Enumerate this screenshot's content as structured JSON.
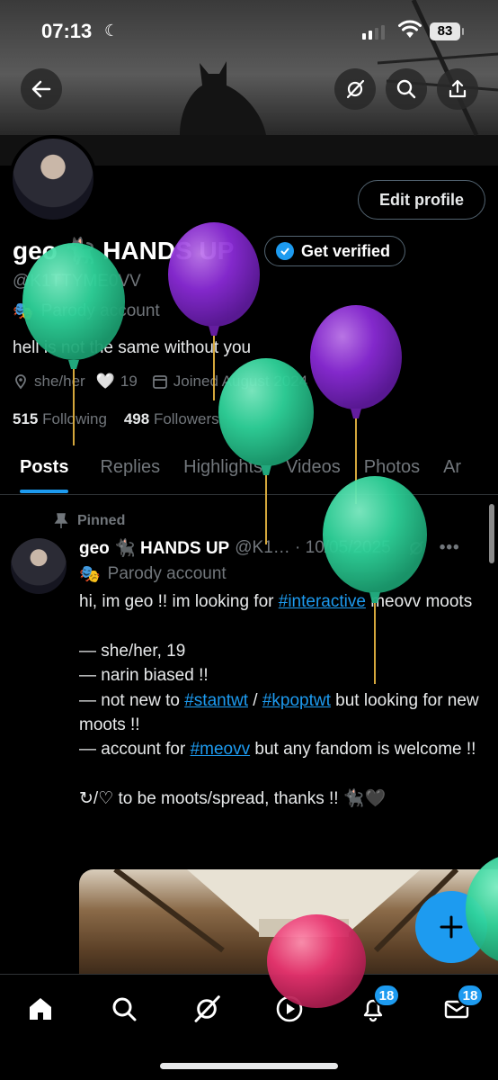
{
  "status_bar": {
    "time": "07:13",
    "battery": "83"
  },
  "profile": {
    "name": "geo 🐈‍⬛ HANDS UP",
    "handle": "@K1TTYME0VV",
    "parody_label": "Parody account",
    "bio": "hell is not the same without you",
    "pronouns": "she/her",
    "heart": "🤍",
    "age": "19",
    "joined": "Joined August 2024",
    "following_count": "515",
    "following_label": "Following",
    "followers_count": "498",
    "followers_label": "Followers",
    "edit_label": "Edit profile",
    "verify_label": "Get verified"
  },
  "tabs": [
    "Posts",
    "Replies",
    "Highlights",
    "Videos",
    "Photos",
    "Ar"
  ],
  "post": {
    "pinned_label": "Pinned",
    "author": "geo 🐈‍⬛ HANDS UP",
    "handle_date": "@K1… · 10/05/2025",
    "parody_label": "Parody account",
    "line1_a": "hi, im geo !! im looking for ",
    "hashtag_interactive": "#interactive",
    "line1_b": " meovv moots",
    "line2": "— she/her, 19",
    "line3": "— narin biased !!",
    "line4_a": "— not new to ",
    "hashtag_stantwt": "#stantwt",
    "line4_sep": " / ",
    "hashtag_kpoptwt": "#kpoptwt",
    "line4_b": " but looking for new moots !!",
    "line5_a": "— account for ",
    "hashtag_meovv": "#meovv",
    "line5_b": " but any fandom is welcome !!",
    "line6": "↻/♡ to be moots/spread, thanks !! 🐈‍⬛🖤"
  },
  "nav": {
    "notifications_badge": "18",
    "messages_badge": "18"
  },
  "colors": {
    "accent": "#1d9bf0",
    "background": "#000000",
    "muted": "#71767b",
    "balloon_green": "#2fd39a",
    "balloon_purple": "#8a2bd6",
    "balloon_pink": "#e8336f"
  }
}
